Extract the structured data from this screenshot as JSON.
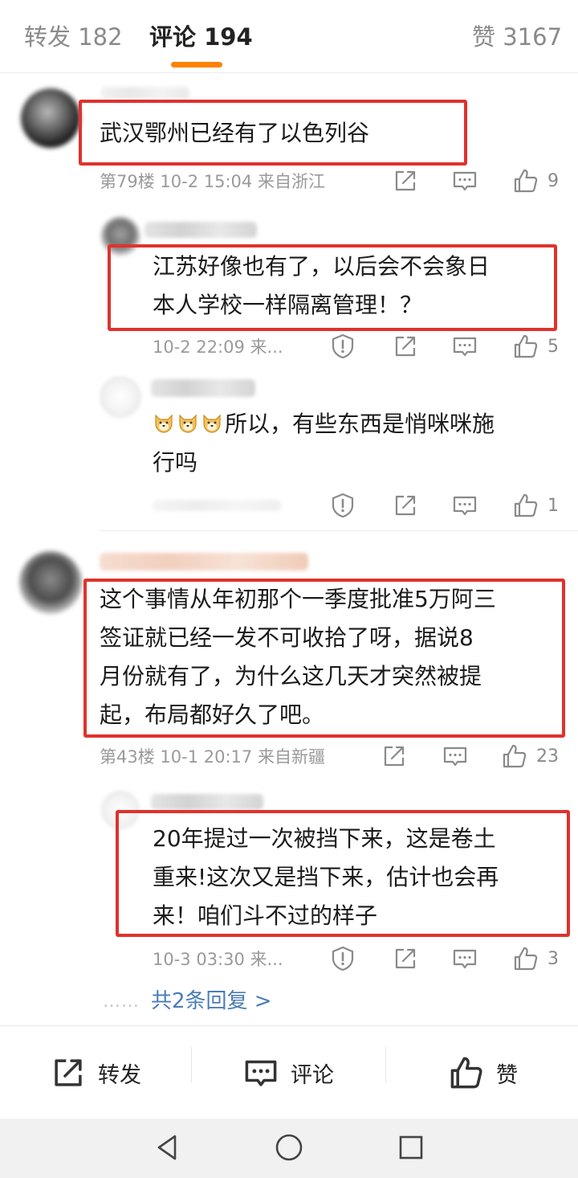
{
  "tabs": {
    "repost": "转发 182",
    "comments": "评论 194",
    "likes": "赞 3167"
  },
  "comments": [
    {
      "text": "武汉鄂州已经有了以色列谷",
      "floor": "第79楼",
      "time": "10-2 15:04",
      "location": "来自浙江",
      "likes": "9"
    },
    {
      "line1": "这个事情从年初那个一季度批准5万阿三",
      "line2": "签证就已经一发不可收拾了呀，据说8",
      "line3": "月份就有了，为什么这几天才突然被提",
      "line4": "起，布局都好久了吧。",
      "floor": "第43楼",
      "time": "10-1 20:17",
      "location": "来自新疆",
      "likes": "23"
    }
  ],
  "replies": [
    {
      "line1": "江苏好像也有了，以后会不会象日",
      "line2": "本人学校一样隔离管理！？",
      "meta": "10-2 22:09  来...",
      "likes": "5"
    },
    {
      "line1": "所以，有些东西是悄咪咪施",
      "line2": "行吗",
      "likes": "1"
    },
    {
      "line1": "20年提过一次被挡下来，这是卷土",
      "line2": "重来!这次又是挡下来，估计也会再",
      "line3": "来！咱们斗不过的样子",
      "meta": "10-3 03:30  来...",
      "likes": "3"
    }
  ],
  "more_replies": {
    "dots": "……",
    "label": "共2条回复 >"
  },
  "bottom_bar": {
    "repost": "转发",
    "comment": "评论",
    "like": "赞"
  },
  "colors": {
    "accent": "#ff8200",
    "highlight_box": "#e0322d",
    "link": "#4a7cb8"
  },
  "icons": [
    "share-icon",
    "comment-icon",
    "like-icon",
    "report-icon",
    "back-icon",
    "home-icon",
    "recents-icon"
  ]
}
